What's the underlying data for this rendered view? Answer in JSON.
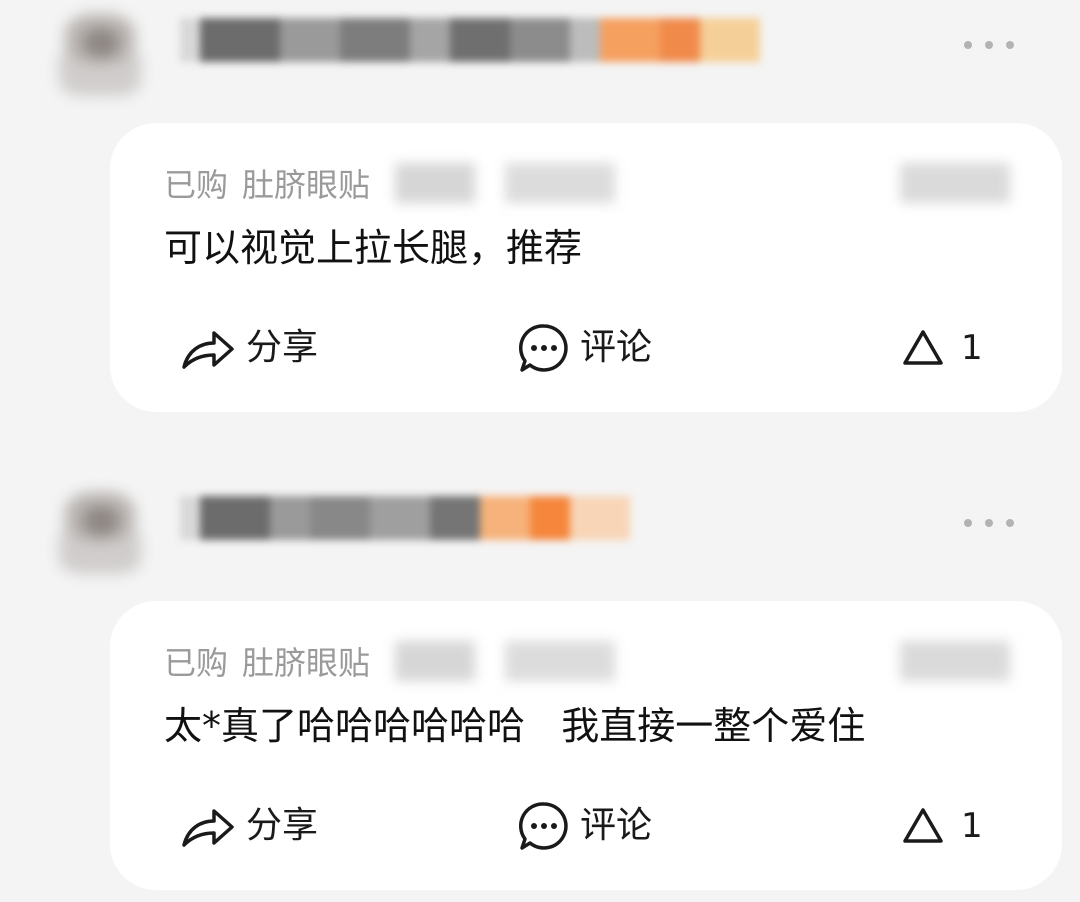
{
  "reviews": [
    {
      "purchase_tag": "已购",
      "product_name": "肚脐眼贴",
      "comment": "可以视觉上拉长腿，推荐",
      "actions": {
        "share_label": "分享",
        "comment_label": "评论",
        "like_count": "1"
      },
      "icons": {
        "more": "more-horizontal-icon",
        "share": "share-arrow-icon",
        "comment": "chat-bubble-icon",
        "like": "triangle-up-icon"
      }
    },
    {
      "purchase_tag": "已购",
      "product_name": "肚脐眼贴",
      "comment": "太*真了哈哈哈哈哈哈   我直接一整个爱住",
      "actions": {
        "share_label": "分享",
        "comment_label": "评论",
        "like_count": "1"
      },
      "icons": {
        "more": "more-horizontal-icon",
        "share": "share-arrow-icon",
        "comment": "chat-bubble-icon",
        "like": "triangle-up-icon"
      }
    }
  ],
  "colors": {
    "background": "#f4f4f4",
    "card": "#ffffff",
    "muted_text": "#9a9a9a",
    "primary_text": "#111111",
    "badge_orange": "#f5863c"
  }
}
